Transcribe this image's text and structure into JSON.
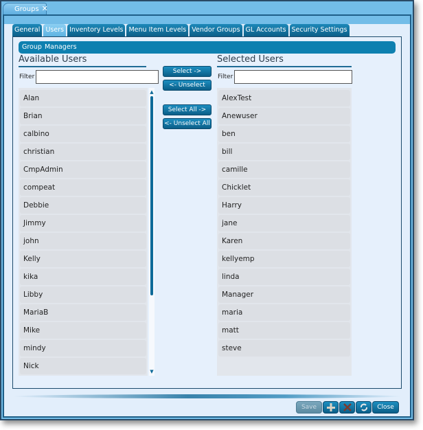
{
  "window": {
    "tab_title": "Groups",
    "close_glyph": "✕"
  },
  "tabs": [
    {
      "label": "General",
      "active": false
    },
    {
      "label": "Users",
      "active": true
    },
    {
      "label": "Inventory Levels",
      "active": false
    },
    {
      "label": "Menu Item Levels",
      "active": false
    },
    {
      "label": "Vendor Groups",
      "active": false
    },
    {
      "label": "GL Accounts",
      "active": false
    },
    {
      "label": "Security Settings",
      "active": false
    }
  ],
  "group": {
    "label": "Group",
    "value": "Managers"
  },
  "available": {
    "title": "Available Users",
    "filter_label": "Filter",
    "filter_value": "",
    "items": [
      "Alan",
      "Brian",
      "calbino",
      "christian",
      "CmpAdmin",
      "compeat",
      "Debbie",
      "Jimmy",
      "john",
      "Kelly",
      "kika",
      "Libby",
      "MariaB",
      "Mike",
      "mindy",
      "Nick"
    ]
  },
  "selected": {
    "title": "Selected Users",
    "filter_label": "Filter",
    "filter_value": "",
    "items": [
      "AlexTest",
      "Anewuser",
      "ben",
      "bill",
      "camille",
      "Chicklet",
      "Harry",
      "jane",
      "Karen",
      "kellyemp",
      "linda",
      "Manager",
      "maria",
      "matt",
      "steve"
    ]
  },
  "actions": {
    "select": "Select ->",
    "unselect": "<- Unselect",
    "select_all": "Select All ->",
    "unselect_all": "<- Unselect All"
  },
  "footer": {
    "save": "Save",
    "add_icon": "plus-icon",
    "delete_icon": "x-icon",
    "refresh_icon": "refresh-icon",
    "close": "Close"
  }
}
